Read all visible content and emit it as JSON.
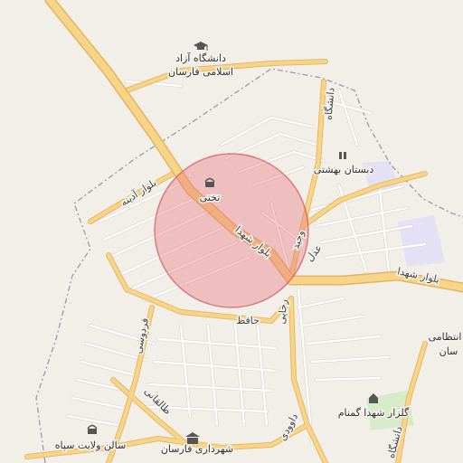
{
  "map": {
    "colors": {
      "background": "#f2efe9",
      "major_road": "#f8d489",
      "major_road_casing": "#e3b55f",
      "minor_road": "#ffffff",
      "minor_road_casing": "#d8d2c8",
      "boundary": "#9a9aa6",
      "highlight_fill": "#e8707a",
      "highlight_stroke": "#d0505a",
      "school_area": "#e4e0f5",
      "park_area": "#d6ecc8"
    },
    "highlight": {
      "shape": "circle",
      "description_visible": false
    },
    "roads": {
      "shohada_blvd_center": "بلوار شهدا",
      "shohada_blvd_east": "بلوار شهدا",
      "adineh_blvd": "بلوار آدینه",
      "vahid": "وحید",
      "adl": "عدل",
      "raja": "رجایی",
      "hafez": "حافظ",
      "ferdowsi": "فردوسی",
      "taleghani": "طالقانی",
      "davoodi": "داوودی",
      "daneshgah_north": "دانشگاه",
      "daneshgah_south": "دانشگاه"
    },
    "pois": {
      "azad_university_line1": "دانشگاه آزاد",
      "azad_university_line2": "اسلامی فارسان",
      "takhti": "تختی",
      "beheshti_school": "دبستان بهشتی",
      "entezami_line1": "انتظامی",
      "entezami_line2": "سان",
      "golzar_shohada": "گلزار شهدا گمنام",
      "velayat_hall": "سالن ولایت سپاه",
      "farsan_municipality": "شهرداری فارسان"
    },
    "icons": {
      "university": "graduation-cap-icon",
      "sports": "stadium-icon",
      "school": "school-icon",
      "monument": "monument-icon",
      "hall": "hall-icon",
      "municipality": "townhall-icon"
    }
  }
}
